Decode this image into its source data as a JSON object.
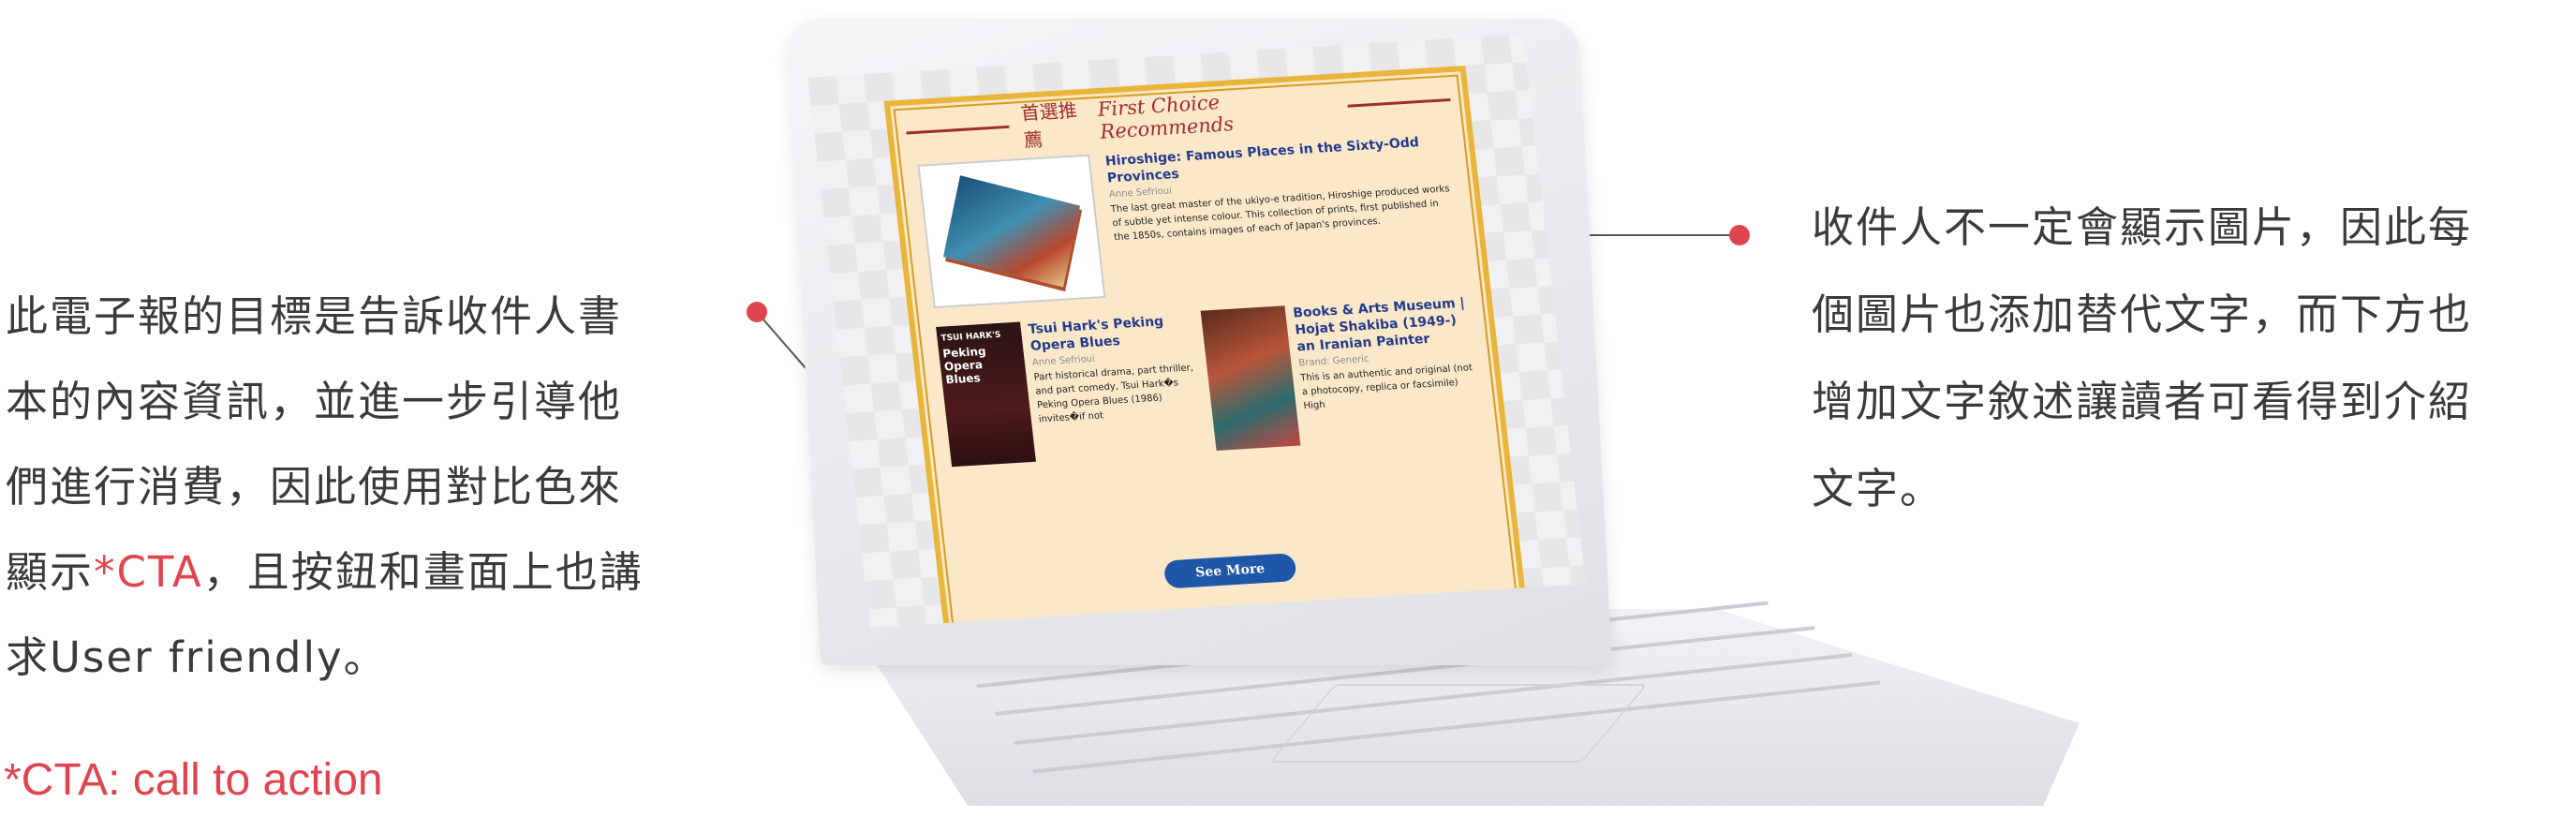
{
  "captions": {
    "left_line1": "此電子報的目標是告訴收件人書",
    "left_line2": "本的內容資訊，並進一步引導他",
    "left_line3": "們進行消費，因此使用對比色來",
    "left_line4_pre": "顯示",
    "left_line4_hl": "*CTA",
    "left_line4_post": "，且按鈕和畫面上也講",
    "left_line5": "求User friendly。",
    "footnote": "*CTA: call to action",
    "right_line1": "收件人不一定會顯示圖片，因此每",
    "right_line2": "個圖片也添加替代文字，而下方也",
    "right_line3": "增加文字敘述讓讀者可看得到介紹",
    "right_line4": "文字。"
  },
  "newsletter": {
    "header_zh": "首選推薦",
    "header_en": "First Choice Recommends",
    "featured": {
      "title": "Hiroshige: Famous Places in the Sixty-Odd Provinces",
      "author": "Anne Sefrioui",
      "description": "The last great master of the ukiyo-e tradition, Hiroshige produced works of subtle yet intense colour. This collection of prints, first published in the 1850s, contains images of each of Japan's provinces."
    },
    "items": [
      {
        "cover_small": "TSUI HARK'S",
        "cover_big": "Peking Opera Blues",
        "title": "Tsui Hark's Peking Opera Blues",
        "author": "Anne Sefrioui",
        "description": "Part historical drama, part thriller, and part comedy, Tsui Hark�s Peking Opera Blues (1986) invites�if not"
      },
      {
        "title": "Books & Arts Museum | Hojat Shakiba (1949-) an Iranian Painter",
        "author": "Brand: Generic",
        "description": "This is an authentic and original (not a photocopy, replica or facsimile) High"
      }
    ],
    "cta_label": "See More"
  },
  "colors": {
    "accent": "#e0454f",
    "cta": "#1e56a8",
    "frame": "#e9b53b",
    "mail_bg": "#fbe8c9"
  }
}
